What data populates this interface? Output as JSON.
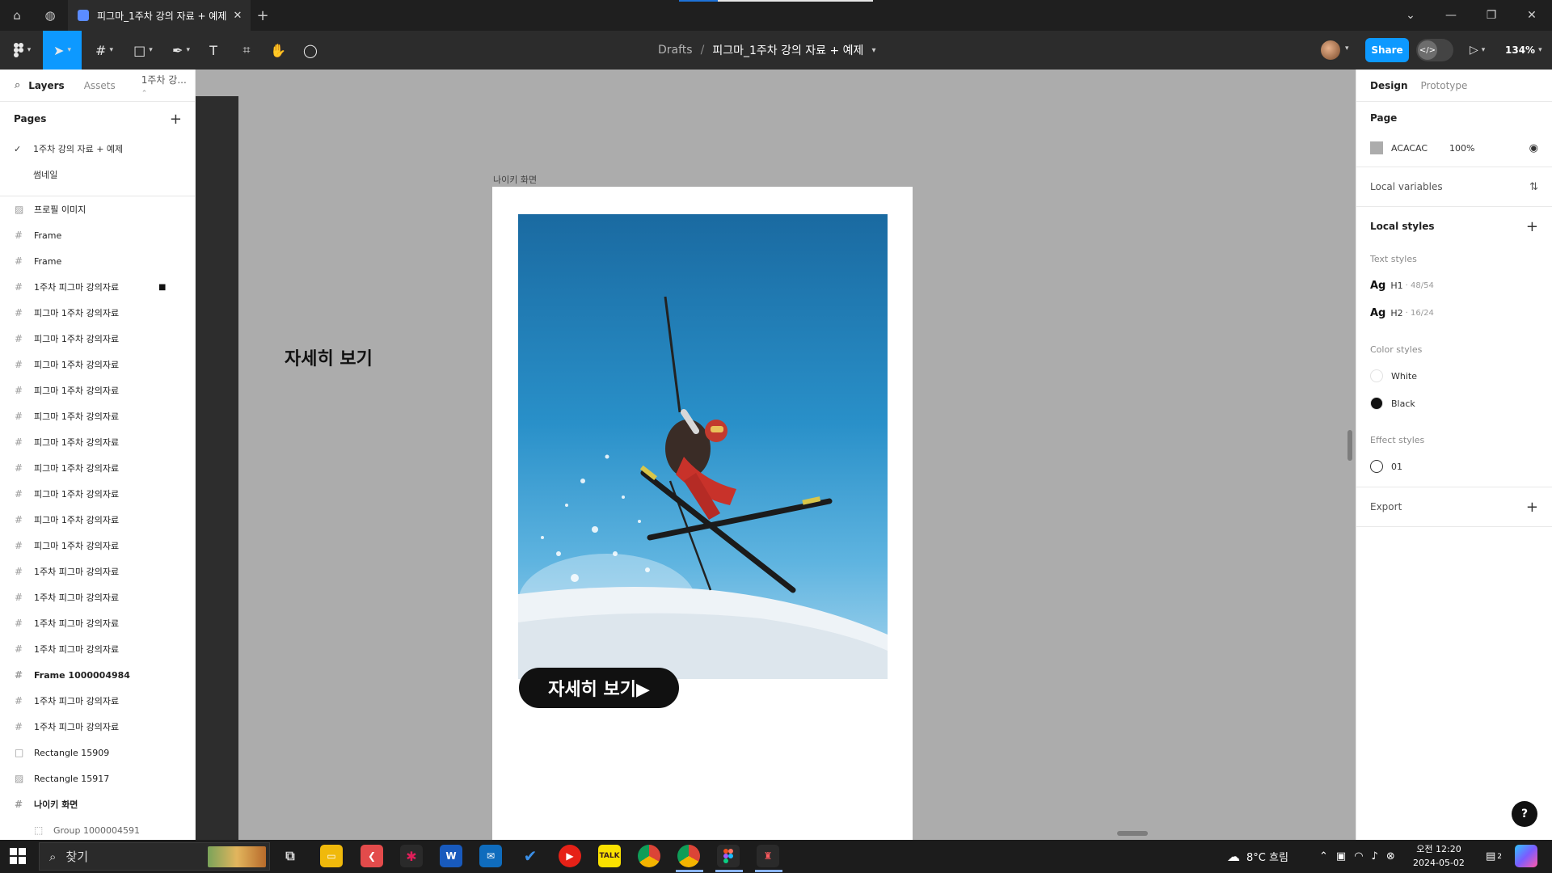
{
  "window": {
    "tab_title": "피그마_1주차 강의 자료 + 예제",
    "tab_close": "✕",
    "new_tab": "+",
    "controls": {
      "dropdown": "⌄",
      "minimize": "—",
      "restore": "❐",
      "close": "✕"
    }
  },
  "toolbar": {
    "breadcrumb_root": "Drafts",
    "breadcrumb_sep": "/",
    "file_name": "피그마_1주차 강의 자료 + 예제",
    "share_label": "Share",
    "zoom": "134%"
  },
  "left_panel": {
    "tabs": {
      "layers": "Layers",
      "assets": "Assets",
      "page_select": "1주차 강..."
    },
    "pages_title": "Pages",
    "pages": [
      {
        "label": "1주차 강의 자료 + 예제",
        "current": true
      },
      {
        "label": "썸네일",
        "current": false
      }
    ],
    "layers": [
      {
        "label": "프로필 이미지",
        "icon": "image",
        "bold": false
      },
      {
        "label": "Frame",
        "icon": "frame",
        "bold": false
      },
      {
        "label": "Frame",
        "icon": "frame",
        "bold": false
      },
      {
        "label": "1주차 피그마 강의자료",
        "icon": "frame",
        "bold": false,
        "locked": true
      },
      {
        "label": "피그마 1주차 강의자료",
        "icon": "frame",
        "bold": false
      },
      {
        "label": "피그마 1주차 강의자료",
        "icon": "frame",
        "bold": false
      },
      {
        "label": "피그마 1주차 강의자료",
        "icon": "frame",
        "bold": false
      },
      {
        "label": "피그마 1주차 강의자료",
        "icon": "frame",
        "bold": false
      },
      {
        "label": "피그마 1주차 강의자료",
        "icon": "frame",
        "bold": false
      },
      {
        "label": "피그마 1주차 강의자료",
        "icon": "frame",
        "bold": false
      },
      {
        "label": "피그마 1주차 강의자료",
        "icon": "frame",
        "bold": false
      },
      {
        "label": "피그마 1주차 강의자료",
        "icon": "frame",
        "bold": false
      },
      {
        "label": "피그마 1주차 강의자료",
        "icon": "frame",
        "bold": false
      },
      {
        "label": "피그마 1주차 강의자료",
        "icon": "frame",
        "bold": false
      },
      {
        "label": "1주차 피그마 강의자료",
        "icon": "frame",
        "bold": false
      },
      {
        "label": "1주차 피그마 강의자료",
        "icon": "frame",
        "bold": false
      },
      {
        "label": "1주차 피그마 강의자료",
        "icon": "frame",
        "bold": false
      },
      {
        "label": "1주차 피그마 강의자료",
        "icon": "frame",
        "bold": false
      },
      {
        "label": "Frame 1000004984",
        "icon": "frame",
        "bold": true
      },
      {
        "label": "1주차 피그마 강의자료",
        "icon": "frame",
        "bold": false
      },
      {
        "label": "1주차 피그마 강의자료",
        "icon": "frame",
        "bold": false
      },
      {
        "label": "Rectangle 15909",
        "icon": "rect",
        "bold": false
      },
      {
        "label": "Rectangle 15917",
        "icon": "image",
        "bold": false
      },
      {
        "label": "나이키 화면",
        "icon": "frame",
        "bold": true
      },
      {
        "label": "Group 1000004591",
        "icon": "group",
        "bold": false,
        "child": true
      }
    ]
  },
  "canvas": {
    "side_text": "자세히 보기",
    "frame_label": "나이키 화면",
    "button_label": "자세히 보기▶"
  },
  "right_panel": {
    "tabs": {
      "design": "Design",
      "prototype": "Prototype"
    },
    "page_title": "Page",
    "page_color": "ACACAC",
    "page_opacity": "100%",
    "local_variables": "Local variables",
    "local_styles": "Local styles",
    "text_styles_title": "Text styles",
    "text_styles": [
      {
        "ag": "Ag",
        "name": "H1",
        "meta": "· 48/54"
      },
      {
        "ag": "Ag",
        "name": "H2",
        "meta": "· 16/24"
      }
    ],
    "color_styles_title": "Color styles",
    "color_styles": [
      {
        "name": "White",
        "color": "#ffffff"
      },
      {
        "name": "Black",
        "color": "#111111"
      }
    ],
    "effect_styles_title": "Effect styles",
    "effect_styles": [
      {
        "name": "01"
      }
    ],
    "export_title": "Export",
    "help": "?"
  },
  "taskbar": {
    "search_placeholder": "찾기",
    "weather": "8°C  흐림",
    "time": "오전 12:20",
    "date": "2024-05-02",
    "notification_count": "2"
  },
  "colors": {
    "accent": "#0d99ff",
    "canvas_bg": "#acacac",
    "toolbar_bg": "#2c2c2c"
  }
}
